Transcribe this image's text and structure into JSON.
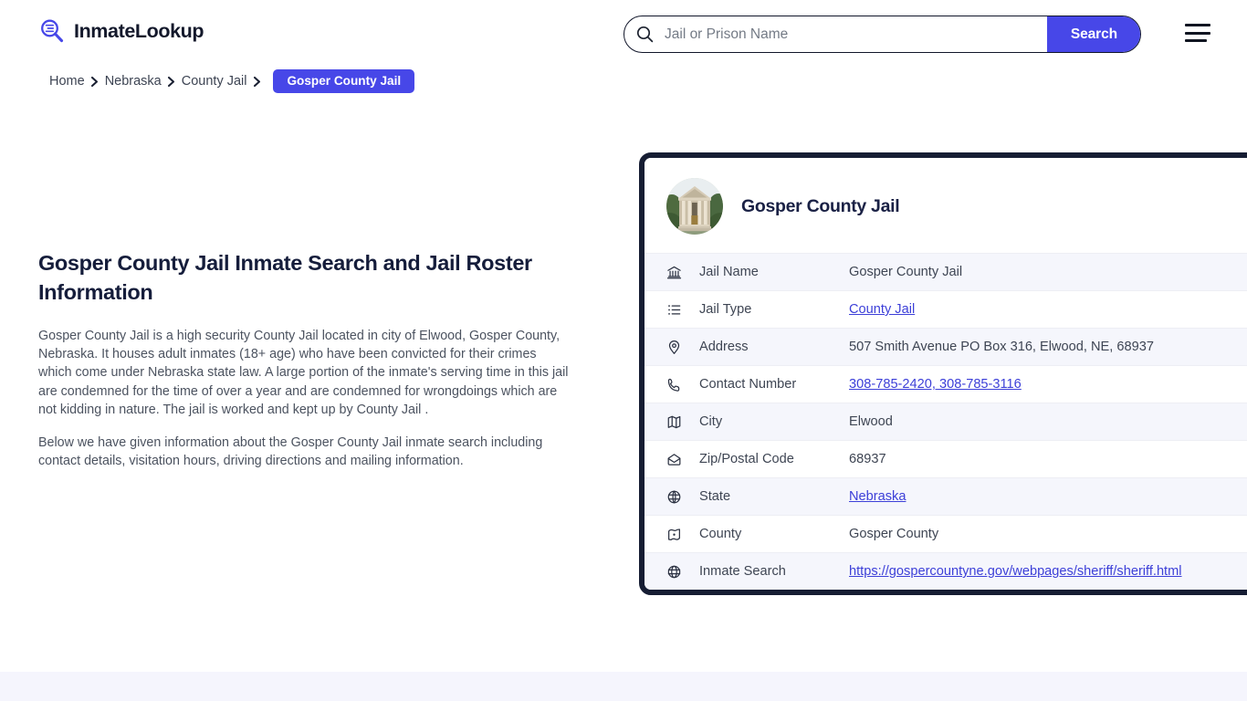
{
  "header": {
    "logo_text": "InmateLookup",
    "logo_icon": "magnifier-list-icon",
    "menu_icon": "hamburger-menu-icon",
    "search": {
      "icon": "search-icon",
      "placeholder": "Jail or Prison Name",
      "value": "",
      "button_label": "Search"
    }
  },
  "breadcrumb": {
    "items": [
      {
        "label": "Home",
        "current": false
      },
      {
        "label": "Nebraska",
        "current": false
      },
      {
        "label": "County Jail",
        "current": false
      },
      {
        "label": "Gosper County Jail",
        "current": true
      }
    ],
    "separator": "›"
  },
  "main": {
    "title": "Gosper County Jail Inmate Search and Jail Roster Information",
    "paragraph_1": "Gosper County Jail is a high security County Jail located in city of Elwood, Gosper County, Nebraska. It houses adult inmates (18+ age) who have been convicted for their crimes which come under Nebraska state law. A large portion of the inmate's serving time in this jail are condemned for the time of over a year and are condemned for wrongdoings which are not kidding in nature. The jail is worked and kept up by County Jail .",
    "paragraph_2": "Below we have given information about the Gosper County Jail inmate search including contact details, visitation hours, driving directions and mailing information."
  },
  "info_card": {
    "avatar_alt": "courthouse-photo",
    "title": "Gosper County Jail",
    "rows": [
      {
        "icon": "bank-icon",
        "label": "Jail Name",
        "value": "Gosper County Jail",
        "link": false
      },
      {
        "icon": "list-icon",
        "label": "Jail Type",
        "value": "County Jail",
        "link": true
      },
      {
        "icon": "map-pin-icon",
        "label": "Address",
        "value": "507 Smith Avenue PO Box 316, Elwood, NE, 68937",
        "link": false
      },
      {
        "icon": "phone-icon",
        "label": "Contact Number",
        "value": "308-785-2420, 308-785-3116",
        "link": true
      },
      {
        "icon": "map-icon",
        "label": "City",
        "value": "Elwood",
        "link": false
      },
      {
        "icon": "envelope-icon",
        "label": "Zip/Postal Code",
        "value": "68937",
        "link": false
      },
      {
        "icon": "globe-pin-icon",
        "label": "State",
        "value": "Nebraska",
        "link": true
      },
      {
        "icon": "county-map-icon",
        "label": "County",
        "value": "Gosper County",
        "link": false
      },
      {
        "icon": "globe-icon",
        "label": "Inmate Search",
        "value": "https://gospercountyne.gov/webpages/sheriff/sheriff.html",
        "link": true
      }
    ]
  },
  "colors": {
    "accent": "#4747e8",
    "link": "#3c3fd8",
    "card_border": "#161d33",
    "row_alt": "#f5f6fc",
    "title": "#151d3b",
    "band": "#f5f5fd"
  }
}
